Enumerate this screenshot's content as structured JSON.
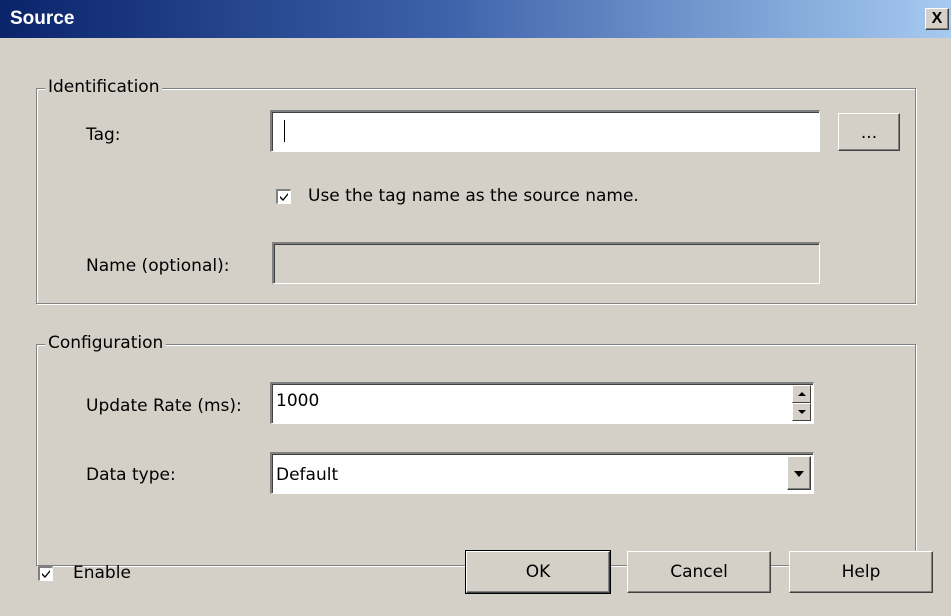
{
  "window": {
    "title": "Source",
    "close_label": "X"
  },
  "identification": {
    "legend": "Identification",
    "tag_label": "Tag:",
    "tag_value": "",
    "browse_label": "...",
    "use_tag_name_label": "Use the tag name as the source name.",
    "use_tag_name_checked": true,
    "name_label": "Name (optional):",
    "name_value": ""
  },
  "configuration": {
    "legend": "Configuration",
    "update_rate_label": "Update Rate (ms):",
    "update_rate_value": "1000",
    "data_type_label": "Data type:",
    "data_type_value": "Default"
  },
  "footer": {
    "enable_label": "Enable",
    "enable_checked": true,
    "ok_label": "OK",
    "cancel_label": "Cancel",
    "help_label": "Help"
  }
}
